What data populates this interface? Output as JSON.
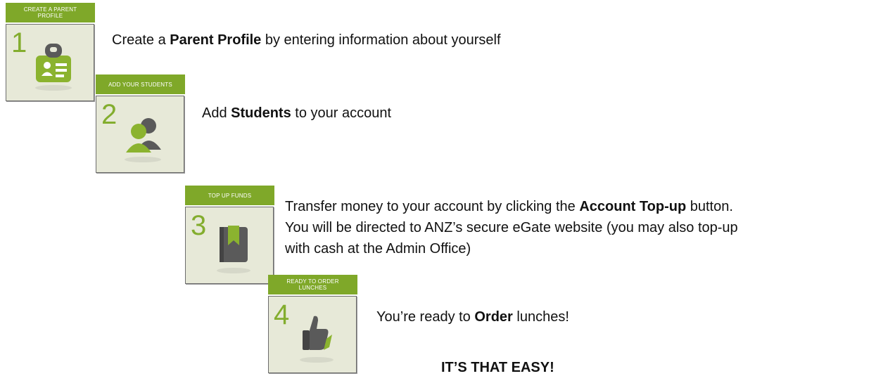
{
  "steps": [
    {
      "number": "1",
      "banner": "CREATE A PARENT PROFILE",
      "icon": "id-badge-icon",
      "text_before": "Create a ",
      "bold": "Parent Profile",
      "text_after": " by entering information about yourself"
    },
    {
      "number": "2",
      "banner": "ADD YOUR STUDENTS",
      "icon": "users-icon",
      "text_before": "Add ",
      "bold": "Students",
      "text_after": " to your account"
    },
    {
      "number": "3",
      "banner": "TOP UP FUNDS",
      "icon": "bookmark-book-icon",
      "line1_before": "Transfer money to your account by clicking the ",
      "line1_bold": "Account Top-up",
      "line1_after": " button.",
      "line2": "You will be directed to ANZ’s secure eGate website (you may also top-up",
      "line3": "with cash at the Admin Office)"
    },
    {
      "number": "4",
      "banner": "READY TO ORDER LUNCHES",
      "icon": "thumbs-up-icon",
      "text_before": "You’re ready to ",
      "bold": "Order",
      "text_after": " lunches!"
    }
  ],
  "footer": "IT’S THAT EASY!",
  "colors": {
    "accent": "#7fa829",
    "tile": "#e7e9d8",
    "icon": "#8bb32f",
    "icon_gray": "#5a5a5a"
  }
}
